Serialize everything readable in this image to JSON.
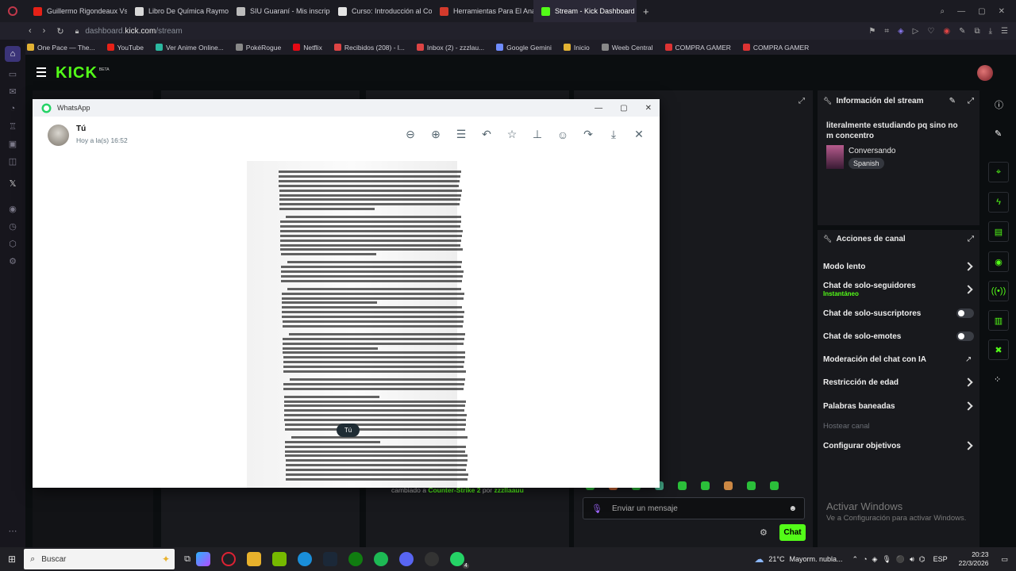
{
  "browser": {
    "tabs": [
      {
        "label": "Guillermo Rigondeaux Vs",
        "color": "#e62117"
      },
      {
        "label": "Libro De Química Raymon",
        "color": "#d8d8d8"
      },
      {
        "label": "SIU Guaraní - Mis inscripc",
        "color": "#bbbbbb"
      },
      {
        "label": "Curso: Introducción al Co",
        "color": "#e4e4e4"
      },
      {
        "label": "Herramientas Para El Anál",
        "color": "#d33a2c"
      },
      {
        "label": "Stream - Kick Dashboard",
        "color": "#53fc18"
      }
    ],
    "url_host": "dashboard.",
    "url_domain": "kick.com",
    "url_path": "/stream",
    "bookmarks": [
      "One Pace — The...",
      "YouTube",
      "Ver Anime Online...",
      "PokéRogue",
      "Netflix",
      "Recibidos (208) - l...",
      "Inbox (2) - zzzlau...",
      "Google Gemini",
      "Inicio",
      "Weeb Central",
      "COMPRA GAMER",
      "COMPRA GAMER"
    ]
  },
  "kick": {
    "logo": "KICK",
    "beta": "BETA",
    "chat_notice_pre": "cambiado a",
    "chat_notice_game": "Counter-Strike 2",
    "chat_notice_mid": "por",
    "chat_notice_user": "zzzllaauu",
    "chat_placeholder": "Enviar un mensaje",
    "chat_button": "Chat",
    "stream_info": {
      "title": "Información del stream",
      "stream_title": "literalmente estudiando pq sino no m concentro",
      "category": "Conversando",
      "language": "Spanish"
    },
    "channel_actions": {
      "title": "Acciones de canal",
      "items": [
        "Modo lento",
        "Chat de solo-seguidores",
        "Chat de solo-suscriptores",
        "Chat de solo-emotes",
        "Moderación del chat con IA",
        "Restricción de edad",
        "Palabras baneadas",
        "Hostear canal",
        "Configurar objetivos"
      ],
      "followers_sub": "Instantáneo"
    }
  },
  "whatsapp": {
    "app": "WhatsApp",
    "sender": "Tú",
    "time": "Hoy a la(s) 16:52",
    "tooltip": "Tú"
  },
  "activate": {
    "title": "Activar Windows",
    "sub": "Ve a Configuración para activar Windows."
  },
  "taskbar": {
    "search": "Buscar",
    "weather": "21°C",
    "weather_text": "Mayorm. nubla...",
    "lang": "ESP",
    "time": "20:23",
    "date": "22/3/2026",
    "wa_badge": "4"
  },
  "colors": {
    "kick_green": "#53fc18",
    "panel": "#18191d",
    "bg": "#0b0e10"
  }
}
